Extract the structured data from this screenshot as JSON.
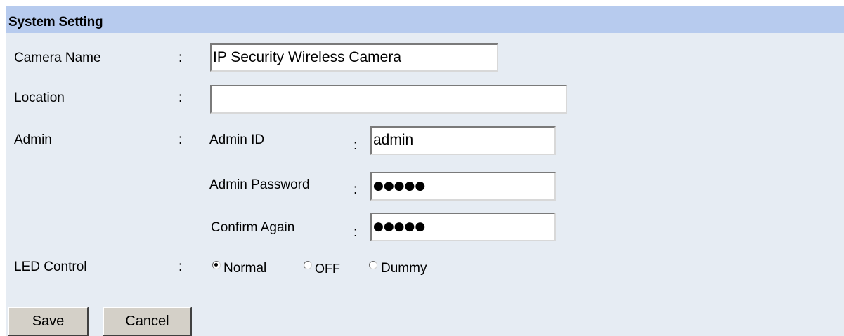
{
  "header": {
    "title": "System Setting"
  },
  "camera_name": {
    "label": "Camera Name",
    "colon": ":",
    "value": "IP Security Wireless Camera"
  },
  "location": {
    "label": "Location",
    "colon": ":",
    "value": ""
  },
  "admin": {
    "label": "Admin",
    "colon": ":",
    "id": {
      "label": "Admin ID",
      "colon": ":",
      "value": "admin"
    },
    "password": {
      "label": "Admin Password",
      "colon": ":",
      "value": "●●●●●"
    },
    "confirm": {
      "label": "Confirm Again",
      "colon": ":",
      "value": "●●●●●"
    }
  },
  "led_control": {
    "label": "LED Control",
    "colon": ":",
    "options": [
      {
        "label": "Normal",
        "selected": true
      },
      {
        "label": "OFF",
        "selected": false
      },
      {
        "label": "Dummy",
        "selected": false
      }
    ]
  },
  "buttons": {
    "save": "Save",
    "cancel": "Cancel"
  },
  "colors": {
    "header_bg": "#b7cbee",
    "panel_bg": "#e6ecf3",
    "button_bg": "#d4d0c8"
  }
}
